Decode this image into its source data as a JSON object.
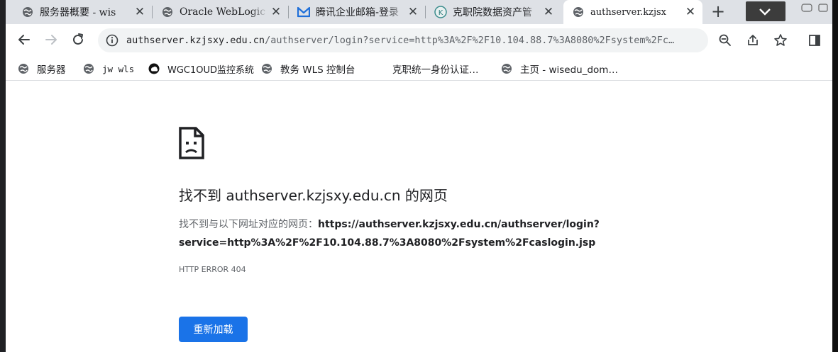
{
  "tabs": [
    {
      "title": "服务器概要 - wis",
      "icon": "globe-icon"
    },
    {
      "title": "Oracle WebLogic",
      "icon": "globe-icon"
    },
    {
      "title": "腾讯企业邮箱-登录",
      "icon": "tencent-mail-icon"
    },
    {
      "title": "克职院数据资产管",
      "icon": "kzjsxy-logo-icon"
    },
    {
      "title": "authserver.kzjsx",
      "icon": "globe-icon",
      "active": true
    }
  ],
  "address_bar": {
    "host": "authserver.kzjsxy.edu.cn",
    "path": "/authserver/login?service=http%3A%2F%2F10.104.88.7%3A8080%2Fsystem%2Fc…"
  },
  "bookmarks": [
    {
      "label": "服务器",
      "icon": "globe-icon"
    },
    {
      "label": "jw wls",
      "icon": "globe-icon"
    },
    {
      "label": "WGC1OUD监控系统",
      "icon": "wgcloud-icon"
    },
    {
      "label": "教务 WLS 控制台",
      "icon": "globe-icon"
    },
    {
      "label": "克职统一身份认证…",
      "icon": "none"
    },
    {
      "label": "主页 - wisedu_dom…",
      "icon": "globe-icon"
    }
  ],
  "error_page": {
    "title": "找不到 authserver.kzjsxy.edu.cn 的网页",
    "desc_prefix": "找不到与以下网址对应的网页：",
    "desc_url_line1": "https://authserver.kzjsxy.edu.cn/authserver/login?",
    "desc_url_line2": "service=http%3A%2F%2F10.104.88.7%3A8080%2Fsystem%2Fcaslogin.jsp",
    "error_code": "HTTP ERROR 404",
    "reload_label": "重新加载"
  },
  "colors": {
    "accent": "#1a73e8",
    "tabstrip": "#dee1e6",
    "text": "#202124",
    "secondary_text": "#5f6368"
  }
}
